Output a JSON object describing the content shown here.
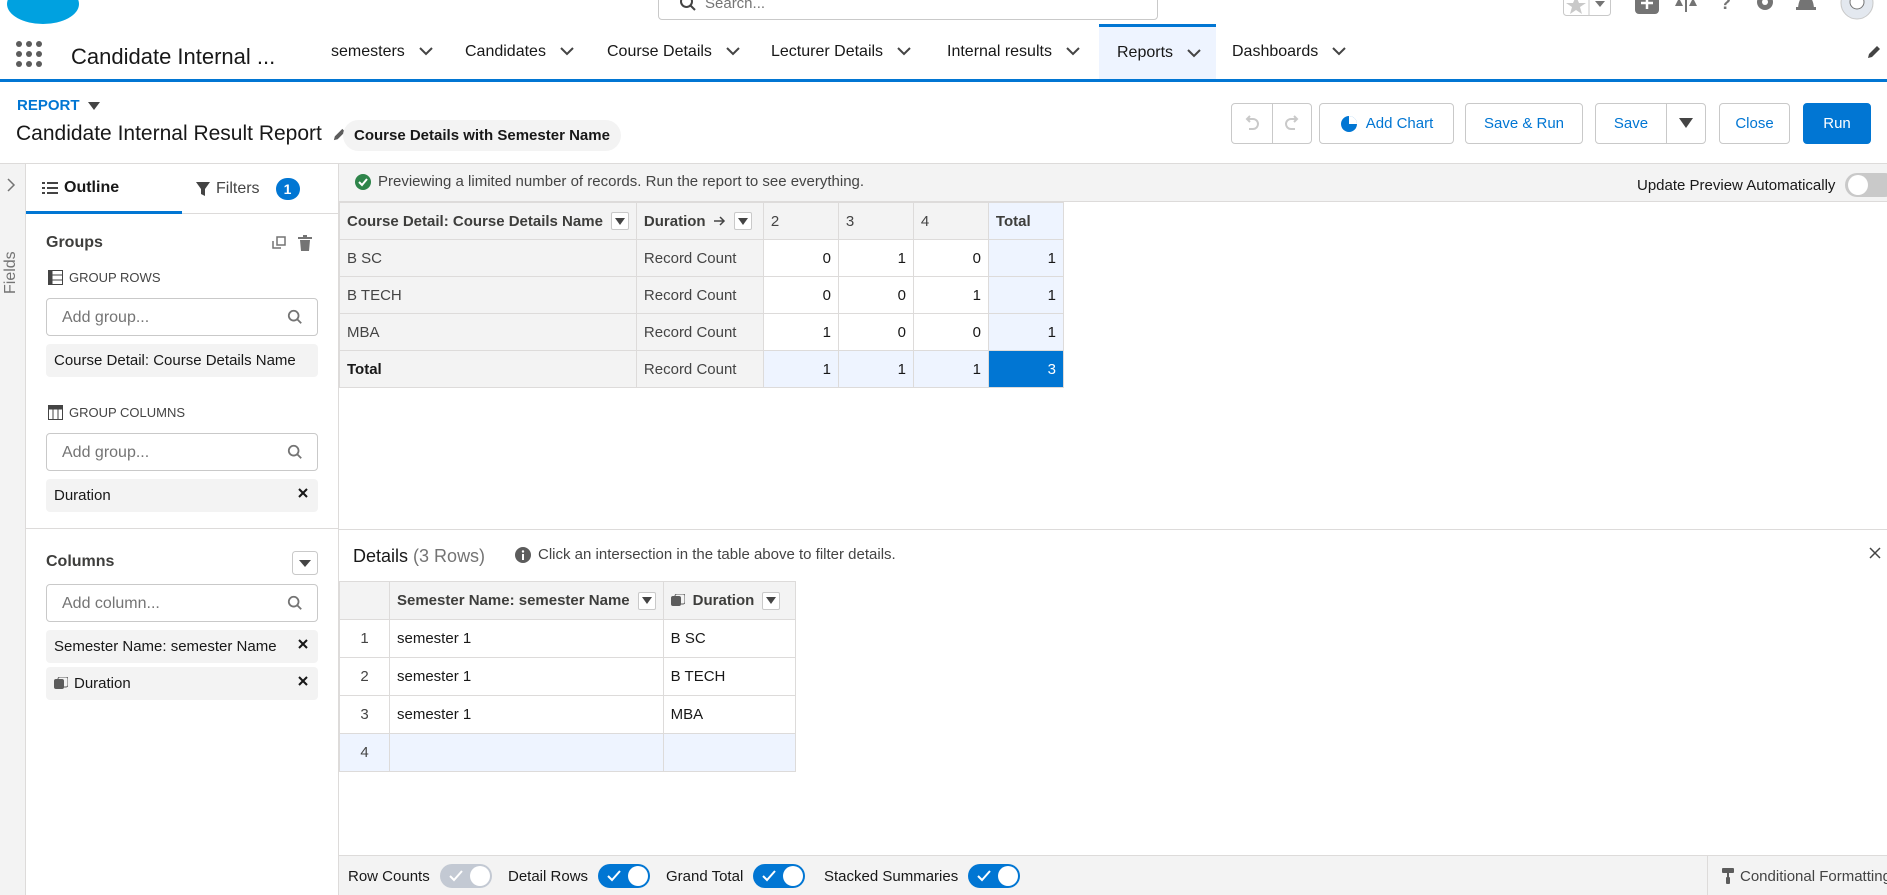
{
  "global_header": {
    "search_placeholder": "Search...",
    "icons": [
      "salesforce-cloud-logo",
      "favorites-star-icon",
      "add-icon",
      "setup-assistant-icon",
      "help-icon",
      "settings-gear-icon",
      "notifications-bell-icon",
      "user-avatar"
    ]
  },
  "app_nav": {
    "app_name": "Candidate Internal ...",
    "tabs": [
      {
        "label": "semesters",
        "active": false
      },
      {
        "label": "Candidates",
        "active": false
      },
      {
        "label": "Course Details",
        "active": false
      },
      {
        "label": "Lecturer Details",
        "active": false
      },
      {
        "label": "Internal results",
        "active": false
      },
      {
        "label": "Reports",
        "active": true
      },
      {
        "label": "Dashboards",
        "active": false
      }
    ]
  },
  "report_header": {
    "object_label": "REPORT",
    "title": "Candidate Internal Result Report",
    "report_type": "Course Details with Semester Name",
    "buttons": {
      "add_chart": "Add Chart",
      "save_run": "Save & Run",
      "save": "Save",
      "close": "Close",
      "run": "Run"
    }
  },
  "fields_rail": {
    "label": "Fields"
  },
  "outline_panel": {
    "tabs": {
      "outline": "Outline",
      "filters": "Filters",
      "filters_count": "1"
    },
    "groups_title": "Groups",
    "group_rows_label": "GROUP ROWS",
    "group_rows_placeholder": "Add group...",
    "group_rows": [
      "Course Detail: Course Details Name"
    ],
    "group_columns_label": "GROUP COLUMNS",
    "group_columns_placeholder": "Add group...",
    "group_columns": [
      "Duration"
    ],
    "columns_title": "Columns",
    "columns_placeholder": "Add column...",
    "columns": [
      "Semester Name: semester Name",
      "Duration"
    ]
  },
  "preview": {
    "message": "Previewing a limited number of records. Run the report to see everything.",
    "update_label": "Update Preview Automatically",
    "update_on": false
  },
  "matrix": {
    "row_group_header": "Course Detail: Course Details Name",
    "col_group_header": "Duration",
    "col_values": [
      "2",
      "3",
      "4"
    ],
    "total_label": "Total",
    "rows": [
      {
        "name": "B SC",
        "measure": "Record Count",
        "values": [
          "0",
          "1",
          "0"
        ],
        "total": "1"
      },
      {
        "name": "B TECH",
        "measure": "Record Count",
        "values": [
          "0",
          "0",
          "1"
        ],
        "total": "1"
      },
      {
        "name": "MBA",
        "measure": "Record Count",
        "values": [
          "1",
          "0",
          "0"
        ],
        "total": "1"
      }
    ],
    "total_row": {
      "name": "Total",
      "measure": "Record Count",
      "values": [
        "1",
        "1",
        "1"
      ],
      "total": "3"
    }
  },
  "details": {
    "title": "Details",
    "row_count": "(3 Rows)",
    "hint": "Click an intersection in the table above to filter details.",
    "headers": [
      "Semester Name: semester Name",
      "Duration"
    ],
    "rows": [
      {
        "num": "1",
        "semester": "semester 1",
        "duration": "B SC"
      },
      {
        "num": "2",
        "semester": "semester 1",
        "duration": "B TECH"
      },
      {
        "num": "3",
        "semester": "semester 1",
        "duration": "MBA"
      },
      {
        "num": "4",
        "semester": "",
        "duration": ""
      }
    ]
  },
  "footer": {
    "row_counts": {
      "label": "Row Counts",
      "on": false
    },
    "detail_rows": {
      "label": "Detail Rows",
      "on": true
    },
    "grand_total": {
      "label": "Grand Total",
      "on": true
    },
    "stacked_summaries": {
      "label": "Stacked Summaries",
      "on": true
    },
    "conditional_formatting": "Conditional Formatting"
  },
  "colors": {
    "brand": "#0176d3",
    "success": "#2e844a",
    "surface": "#f3f3f3"
  }
}
